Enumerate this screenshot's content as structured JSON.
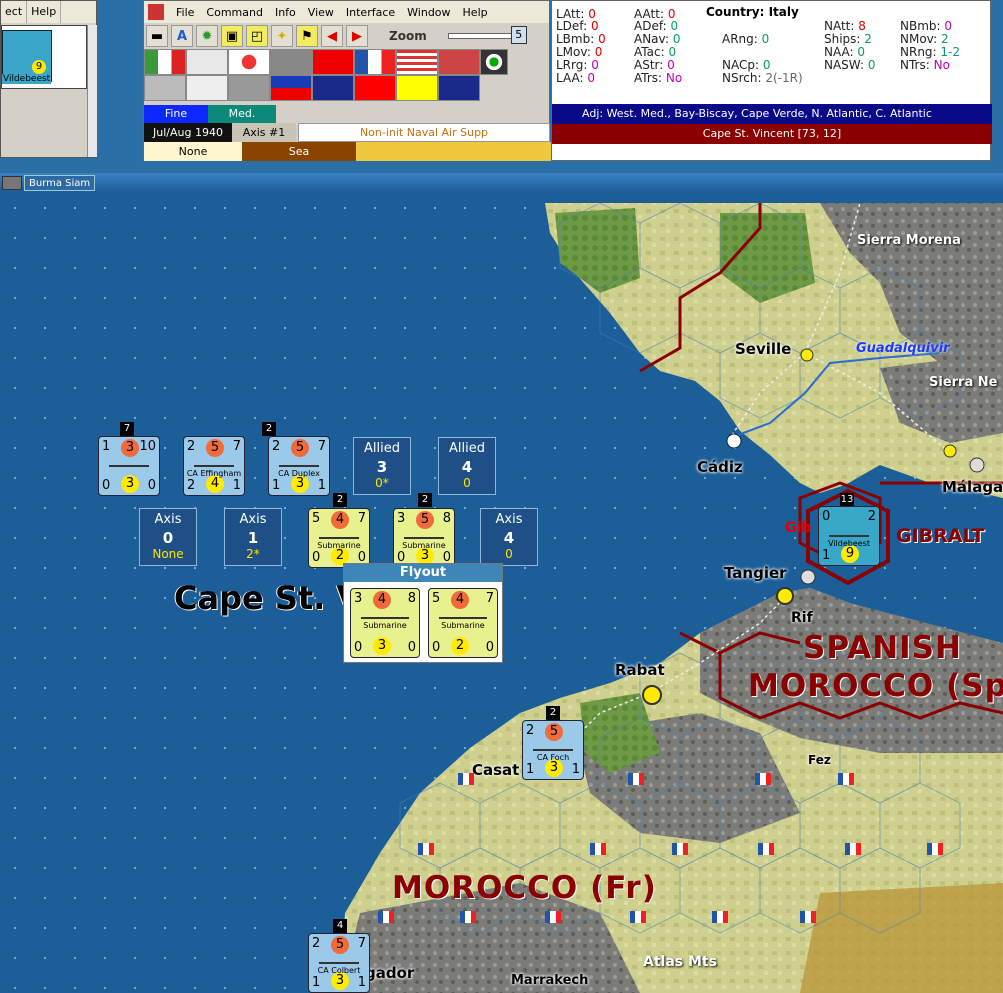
{
  "left_window": {
    "menu": [
      "ect",
      "Help"
    ],
    "unit_name": "Vildebeest",
    "unit_value": "9"
  },
  "main_window": {
    "menu": [
      "File",
      "Command",
      "Info",
      "View",
      "Interface",
      "Window",
      "Help"
    ],
    "toolbar_icons": [
      "truck-icon",
      "letter-a-icon",
      "gear-icon",
      "select-icon",
      "select-all-icon",
      "brightness-icon",
      "flag-icon",
      "arrow-left-icon",
      "arrow-right-icon"
    ],
    "zoom_label": "Zoom",
    "zoom_value": "5",
    "weather_1": "Fine",
    "weather_2": "Med.",
    "date": "Jul/Aug 1940",
    "impulse": "Axis #1",
    "supply_status": "Non-init Naval Air Supp",
    "terrain_1": "None",
    "terrain_2": "Sea"
  },
  "info_panel": {
    "country_label": "Country:",
    "country": "Italy",
    "stats": [
      {
        "k": "LAtt:",
        "v": "0",
        "c": "red"
      },
      {
        "k": "LDef:",
        "v": "0",
        "c": "red"
      },
      {
        "k": "LBmb:",
        "v": "0",
        "c": "red"
      },
      {
        "k": "LMov:",
        "v": "0",
        "c": "red"
      },
      {
        "k": "LRrg:",
        "v": "0",
        "c": "pur"
      },
      {
        "k": "LAA:",
        "v": "0",
        "c": "pur"
      },
      {
        "k": "AAtt:",
        "v": "0",
        "c": "red"
      },
      {
        "k": "ADef:",
        "v": "0",
        "c": "grn"
      },
      {
        "k": "ANav:",
        "v": "0",
        "c": "grn"
      },
      {
        "k": "ATac:",
        "v": "0",
        "c": "grn"
      },
      {
        "k": "AStr:",
        "v": "0",
        "c": "pur"
      },
      {
        "k": "ATrs:",
        "v": "No",
        "c": "pur"
      },
      {
        "k": "ARng:",
        "v": "0",
        "c": "grn"
      },
      {
        "k": "NACp:",
        "v": "0",
        "c": "grn"
      },
      {
        "k": "NSrch:",
        "v": "2(-1R)",
        "c": "gry"
      },
      {
        "k": "NAtt:",
        "v": "8",
        "c": "red"
      },
      {
        "k": "Ships:",
        "v": "2",
        "c": "grn"
      },
      {
        "k": "NAA:",
        "v": "0",
        "c": "grn"
      },
      {
        "k": "NASW:",
        "v": "0",
        "c": "grn"
      },
      {
        "k": "NBmb:",
        "v": "0",
        "c": "pur"
      },
      {
        "k": "NMov:",
        "v": "2",
        "c": "grn"
      },
      {
        "k": "NRng:",
        "v": "1-2",
        "c": "grn"
      },
      {
        "k": "NTrs:",
        "v": "No",
        "c": "pur"
      }
    ],
    "adjacent": "Adj: West. Med., Bay-Biscay, Cape Verde, N. Atlantic, C. Atlantic",
    "location": "Cape St. Vincent [73, 12]"
  },
  "tabstrip": {
    "tab": "Burma Siam"
  },
  "map": {
    "labels": {
      "sierra_morena": "Sierra Morena",
      "seville": "Seville",
      "guadalquivir": "Guadalquivir",
      "sierra_nevada": "Sierra Ne",
      "cadiz": "Cádiz",
      "malaga": "Málaga",
      "gibraltar_city": "Gib",
      "gibraltar_region": "GIBRALT",
      "tangier": "Tangier",
      "rif": "Rif",
      "spanish": "SPANISH",
      "morocco_sp": "MOROCCO (Sp",
      "rabat": "Rabat",
      "casablanca": "Casat",
      "fez": "Fez",
      "morocco_fr": "MOROCCO (Fr)",
      "mogador": "gador",
      "marrakech": "Marrakech",
      "atlas": "Atlas Mts",
      "sea_zone": "Cape St. V"
    },
    "stack_counts": {
      "ship1": "7",
      "ship3": "2",
      "sub1": "2",
      "sub2": "2",
      "gib": "13",
      "foch": "2",
      "colbert": "4"
    },
    "summaries": [
      {
        "title": "Allied",
        "num": "3",
        "sub": "0*"
      },
      {
        "title": "Allied",
        "num": "4",
        "sub": "0"
      },
      {
        "title": "Axis",
        "num": "0",
        "sub": "None"
      },
      {
        "title": "Axis",
        "num": "1",
        "sub": "2*"
      },
      {
        "title": "Axis",
        "num": "4",
        "sub": "0"
      }
    ],
    "counters": {
      "ship1": {
        "a": "1",
        "b": "3",
        "c": "10",
        "d": "0",
        "e": "3",
        "f": "0",
        "name": ""
      },
      "ship2": {
        "a": "2",
        "b": "5",
        "c": "7",
        "d": "2",
        "e": "4",
        "f": "1",
        "name": "CA Effingham"
      },
      "ship3": {
        "a": "2",
        "b": "5",
        "c": "7",
        "d": "1",
        "e": "3",
        "f": "1",
        "name": "CA Duplex"
      },
      "sub1": {
        "a": "5",
        "b": "4",
        "c": "7",
        "d": "0",
        "e": "2",
        "f": "0",
        "name": "Submarine"
      },
      "sub2": {
        "a": "3",
        "b": "5",
        "c": "8",
        "d": "0",
        "e": "3",
        "f": "0",
        "name": "Submarine"
      },
      "fly1": {
        "a": "3",
        "b": "4",
        "c": "8",
        "d": "0",
        "e": "3",
        "f": "0",
        "name": "Submarine"
      },
      "fly2": {
        "a": "5",
        "b": "4",
        "c": "7",
        "d": "0",
        "e": "2",
        "f": "0",
        "name": "Submarine"
      },
      "foch": {
        "a": "2",
        "b": "5",
        "c": "",
        "d": "1",
        "e": "3",
        "f": "1",
        "name": "CA Foch"
      },
      "colbert": {
        "a": "2",
        "b": "5",
        "c": "7",
        "d": "1",
        "e": "3",
        "f": "1",
        "name": "CA Colbert"
      },
      "gib": {
        "a": "0",
        "b": "",
        "c": "2",
        "d": "1",
        "e": "9",
        "f": "",
        "name": "Vildebeest"
      }
    },
    "flyout_title": "Flyout"
  },
  "colors": {
    "sea": "#1c5e98",
    "land_spain": "#c9cc8a",
    "land_morocco": "#cfd195",
    "mountain": "#7d7d7d",
    "border": "#8b0000",
    "axis_sub": "#e7f28e",
    "allied_ship": "#9ac9e9"
  }
}
